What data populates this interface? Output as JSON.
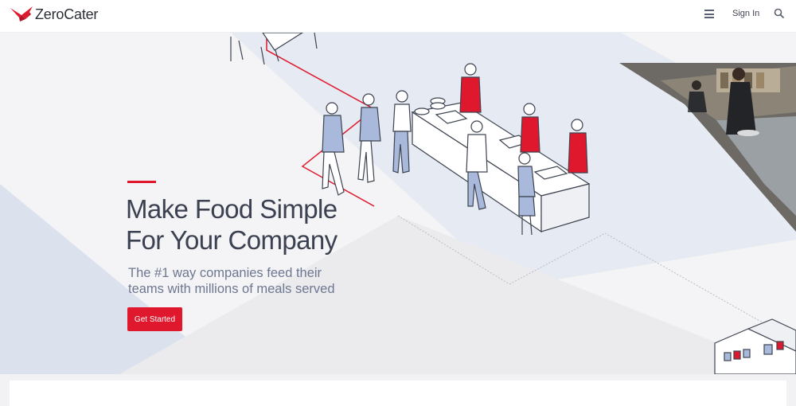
{
  "brand": {
    "name": "ZeroCater",
    "accent_color": "#e0182d"
  },
  "nav": {
    "menu_icon": "hamburger-menu-icon",
    "sign_in_label": "Sign In",
    "search_icon": "search-icon"
  },
  "hero": {
    "headline_line1": "Make Food Simple",
    "headline_line2": "For Your Company",
    "subheadline_line1": "The #1 way companies feed their",
    "subheadline_line2": "teams with millions of meals served",
    "cta_label": "Get Started"
  }
}
